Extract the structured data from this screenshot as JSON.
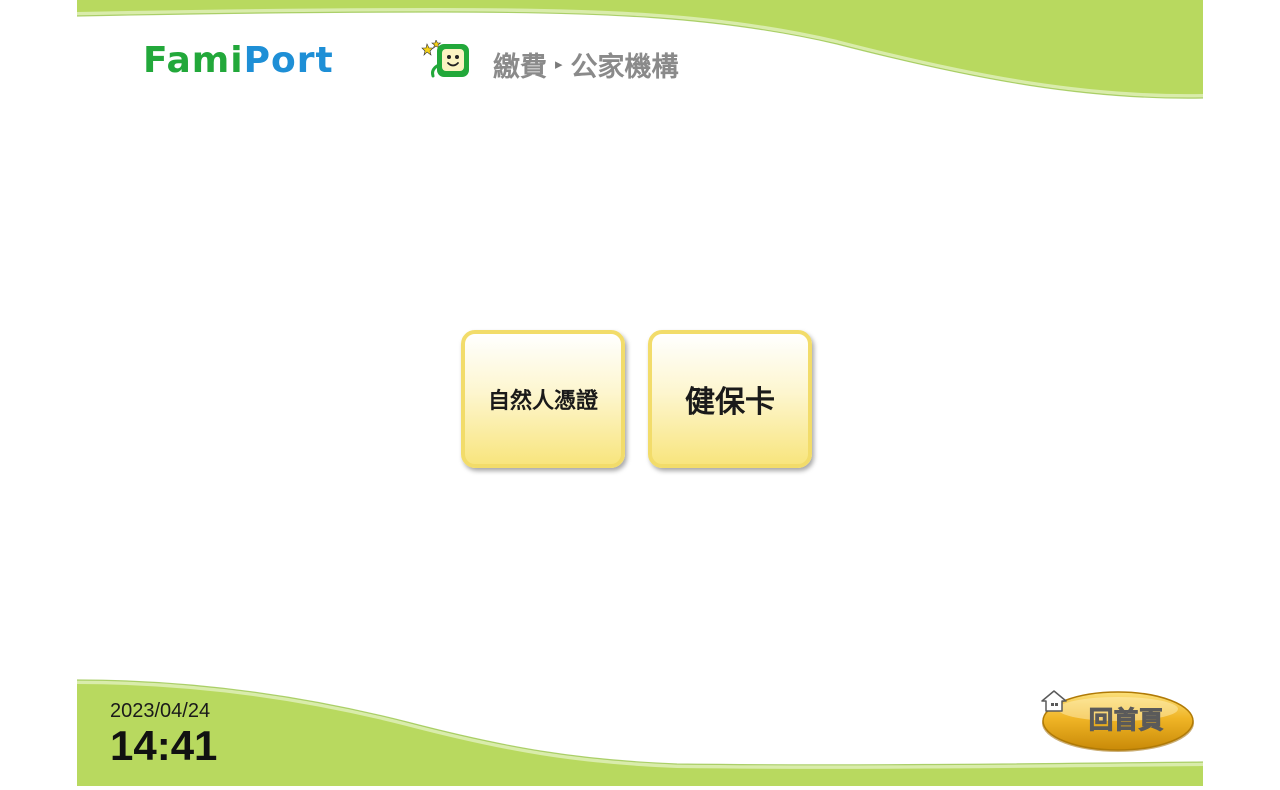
{
  "header": {
    "logo_fami": "Fami",
    "logo_port": "Port",
    "breadcrumb_section": "繳費",
    "breadcrumb_separator": "▸",
    "breadcrumb_page": "公家機構"
  },
  "options": [
    {
      "label": "自然人憑證"
    },
    {
      "label": "健保卡"
    }
  ],
  "footer": {
    "date": "2023/04/24",
    "time": "14:41",
    "home_label": "回首頁"
  },
  "colors": {
    "wave_green": "#b8d95f",
    "wave_light": "#d9ecab",
    "button_border": "#f2dc6a",
    "home_gold": "#e8a912",
    "logo_green": "#22a83a",
    "logo_blue": "#1e8fd6"
  }
}
